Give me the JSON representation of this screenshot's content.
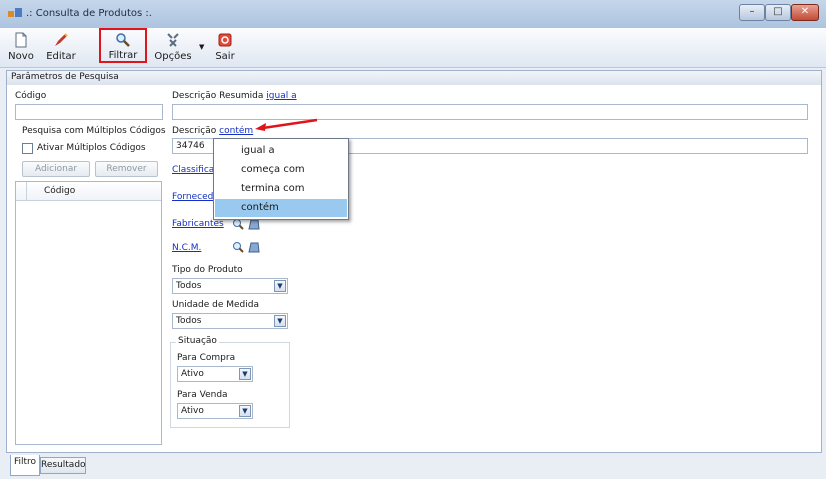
{
  "window": {
    "title": ".: Consulta de Produtos :.",
    "min_glyph": "–",
    "max_glyph": "□",
    "close_glyph": "✕"
  },
  "toolbar": {
    "buttons": [
      {
        "label": "Novo",
        "icon": "new-document-icon"
      },
      {
        "label": "Editar",
        "icon": "edit-icon"
      },
      {
        "label": "Filtrar",
        "icon": "search-icon"
      },
      {
        "label": "Opções",
        "icon": "options-icon"
      },
      {
        "label": "Sair",
        "icon": "exit-icon"
      }
    ],
    "dropdown_glyph": "▼"
  },
  "panel": {
    "header": "Parâmetros de Pesquisa",
    "codigo_label": "Código",
    "codigo_value": "",
    "multi": {
      "title": "Pesquisa com Múltiplos Códigos",
      "checkbox_label": "Ativar Múltiplos Códigos",
      "add_label": "Adicionar",
      "remove_label": "Remover",
      "grid_header": "Código"
    },
    "descricao_resumida": {
      "label": "Descrição Resumida",
      "mode": "igual a",
      "value": ""
    },
    "descricao": {
      "label": "Descrição",
      "mode": "contém",
      "value": "34746"
    },
    "links": {
      "classificacao": "Classifica",
      "fornecedores": "Forneced",
      "fabricantes": "Fabricantes",
      "ncm": "N.C.M."
    },
    "tipo_produto": {
      "label": "Tipo do Produto",
      "value": "Todos"
    },
    "unidade_medida": {
      "label": "Unidade de Medida",
      "value": "Todos"
    },
    "situacao": {
      "title": "Situação",
      "compra_label": "Para Compra",
      "compra_value": "Ativo",
      "venda_label": "Para Venda",
      "venda_value": "Ativo"
    },
    "combo_glyph": "▼"
  },
  "match_menu": {
    "items": [
      "igual a",
      "começa com",
      "termina com",
      "contém"
    ],
    "selected": "contém"
  },
  "tabs": [
    "Filtro",
    "Resultado"
  ],
  "colors": {
    "highlight_border": "#e0141b",
    "link": "#1530c6",
    "menu_selected": "#99c9ef"
  }
}
